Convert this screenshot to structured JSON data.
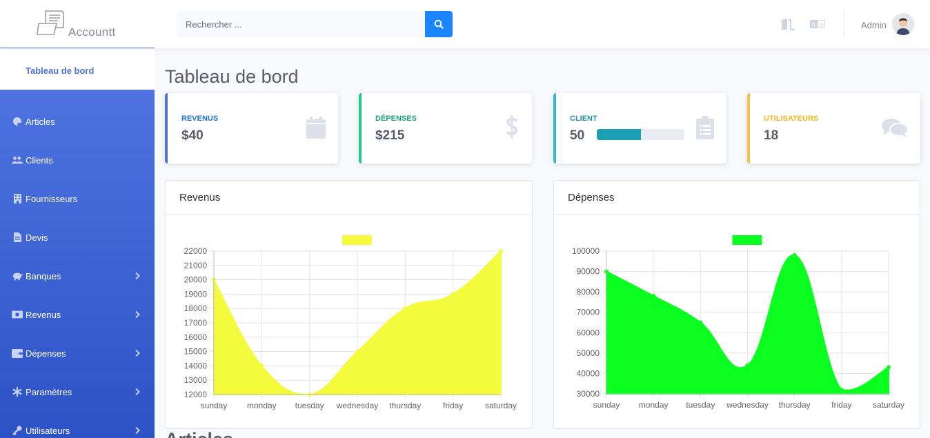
{
  "app": {
    "logo_text": "Accountt"
  },
  "search": {
    "placeholder": "Rechercher ..."
  },
  "user": {
    "name": "Admin"
  },
  "sidebar": {
    "active": "Tableau de bord",
    "items": [
      {
        "label": "Articles",
        "icon": "palette-icon",
        "chevron": false
      },
      {
        "label": "Clients",
        "icon": "users-icon",
        "chevron": false
      },
      {
        "label": "Fournisseurs",
        "icon": "building-icon",
        "chevron": false
      },
      {
        "label": "Devis",
        "icon": "file-icon",
        "chevron": false
      },
      {
        "label": "Banques",
        "icon": "piggy-bank-icon",
        "chevron": true
      },
      {
        "label": "Revenus",
        "icon": "money-bill-icon",
        "chevron": true
      },
      {
        "label": "Dépenses",
        "icon": "wallet-icon",
        "chevron": true
      },
      {
        "label": "Paramètres",
        "icon": "asterisk-icon",
        "chevron": true
      },
      {
        "label": "Utilisateurs",
        "icon": "key-icon",
        "chevron": true
      }
    ]
  },
  "page": {
    "title": "Tableau de bord",
    "next_section": "Articles"
  },
  "cards": [
    {
      "label": "Revenus",
      "value": "$40",
      "color": "#4e73df",
      "label_color": "#1c6fd6",
      "icon": "calendar-icon"
    },
    {
      "label": "Dépenses",
      "value": "$215",
      "color": "#1cc88a",
      "label_color": "#17a673",
      "icon": "dollar-icon"
    },
    {
      "label": "Client",
      "value": "50",
      "color": "#36b9cc",
      "label_color": "#258fa8",
      "icon": "clipboard-icon",
      "progress": 0.5
    },
    {
      "label": "Utilisateurs",
      "value": "18",
      "color": "#f6c23e",
      "label_color": "#f4b619",
      "icon": "comments-icon"
    }
  ],
  "chart_data": [
    {
      "type": "area",
      "title": "Revenus",
      "legend_color": "#f4fb3d",
      "categories": [
        "sunday",
        "monday",
        "tuesday",
        "wednesday",
        "thursday",
        "friday",
        "saturday"
      ],
      "values": [
        20000,
        14000,
        12000,
        15000,
        18000,
        19000,
        22000
      ],
      "ylim": [
        12000,
        22000
      ],
      "yticks": [
        12000,
        13000,
        14000,
        15000,
        16000,
        17000,
        18000,
        19000,
        20000,
        21000,
        22000
      ],
      "grid": true,
      "fill": "#f4fb3d"
    },
    {
      "type": "area",
      "title": "Dépenses",
      "legend_color": "#0aff21",
      "categories": [
        "sunday",
        "monday",
        "tuesday",
        "wednesday",
        "thursday",
        "friday",
        "saturday"
      ],
      "values": [
        90000,
        78000,
        65000,
        44000,
        98000,
        32000,
        43000
      ],
      "ylim": [
        30000,
        100000
      ],
      "yticks": [
        30000,
        40000,
        50000,
        60000,
        70000,
        80000,
        90000,
        100000
      ],
      "grid": true,
      "fill": "#0aff21"
    }
  ]
}
